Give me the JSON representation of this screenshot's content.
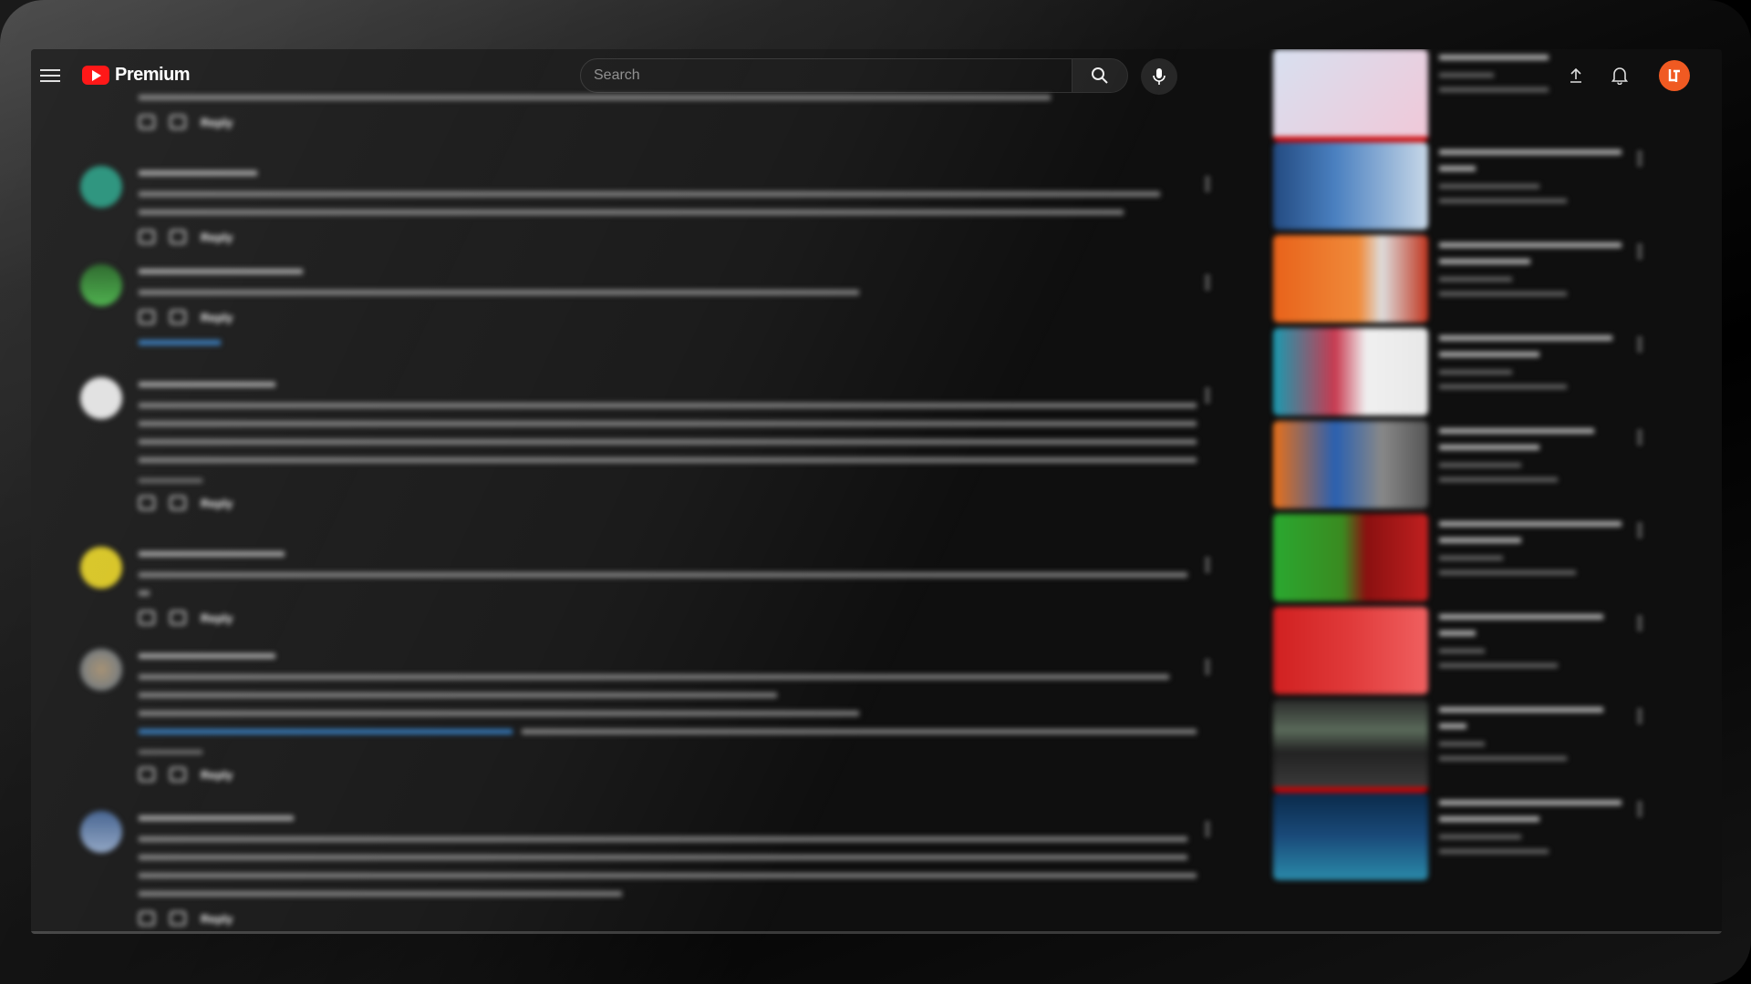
{
  "header": {
    "logo_text": "Premium",
    "search_placeholder": "Search"
  },
  "colors": {
    "brand_red": "#ff0000",
    "background": "#0f0f0f",
    "link_blue": "#3ea6ff",
    "avatar_orange": "#f05a22"
  },
  "icons": [
    "menu-icon",
    "youtube-play-icon",
    "search-icon",
    "microphone-icon",
    "upload-icon",
    "bell-icon",
    "account-avatar"
  ],
  "comments": [
    {
      "author": "",
      "time": "",
      "text": "",
      "likes": "",
      "reply": "Reply",
      "more": ""
    },
    {
      "author": "",
      "time": "",
      "text": "",
      "likes": "",
      "reply": "Reply",
      "more": ""
    },
    {
      "author": "",
      "time": "",
      "text": "",
      "likes": "",
      "reply": "Reply",
      "replies": "",
      "more": ""
    },
    {
      "author": "",
      "time": "",
      "text": "",
      "likes": "",
      "reply": "Reply",
      "more": ""
    },
    {
      "author": "",
      "time": "",
      "text": "",
      "likes": "",
      "reply": "Reply",
      "more": ""
    },
    {
      "author": "",
      "time": "",
      "text": "",
      "likes": "",
      "reply": "Reply",
      "more": ""
    },
    {
      "author": "",
      "time": "",
      "text": "",
      "likes": "",
      "reply": "Reply",
      "more": ""
    }
  ],
  "recommendations": [
    {
      "title": "",
      "channel": "",
      "stats": ""
    },
    {
      "title": "",
      "channel": "",
      "stats": ""
    },
    {
      "title": "",
      "channel": "",
      "stats": ""
    },
    {
      "title": "",
      "channel": "",
      "stats": ""
    },
    {
      "title": "",
      "channel": "",
      "stats": ""
    },
    {
      "title": "",
      "channel": "",
      "stats": ""
    },
    {
      "title": "",
      "channel": "",
      "stats": ""
    },
    {
      "title": "",
      "channel": "",
      "stats": ""
    },
    {
      "title": "",
      "channel": "",
      "stats": ""
    }
  ]
}
